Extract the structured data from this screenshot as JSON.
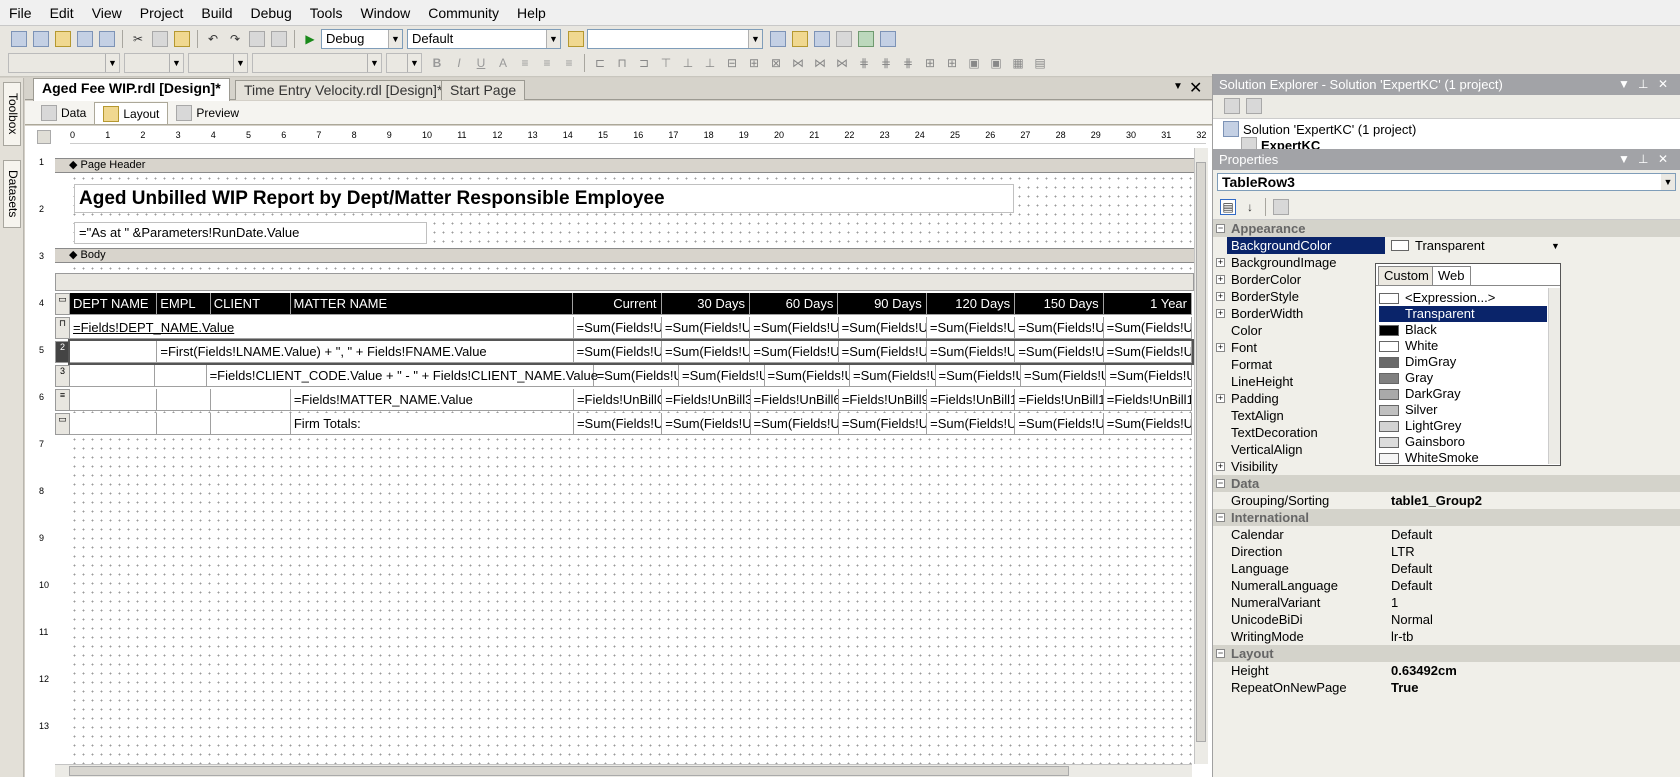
{
  "menu": [
    "File",
    "Edit",
    "View",
    "Project",
    "Build",
    "Debug",
    "Tools",
    "Window",
    "Community",
    "Help"
  ],
  "toolbar": {
    "config": "Debug",
    "platform": "Default"
  },
  "side_tabs": {
    "toolbox": "Toolbox",
    "datasets": "Datasets"
  },
  "doc_tabs": [
    {
      "label": "Aged Fee WIP.rdl [Design]*",
      "active": true
    },
    {
      "label": "Time Entry Velocity.rdl [Design]*",
      "active": false
    },
    {
      "label": "Start Page",
      "active": false
    }
  ],
  "view_tabs": [
    "Data",
    "Layout",
    "Preview"
  ],
  "ruler": {
    "h": [
      "0",
      "1",
      "2",
      "3",
      "4",
      "5",
      "6",
      "7",
      "8",
      "9",
      "10",
      "11",
      "12",
      "13",
      "14",
      "15",
      "16",
      "17",
      "18",
      "19",
      "20",
      "21",
      "22",
      "23",
      "24",
      "25",
      "26",
      "27",
      "28",
      "29",
      "30",
      "31",
      "32"
    ],
    "v": [
      "1",
      "2",
      "3",
      "4",
      "5",
      "6",
      "7",
      "8",
      "9",
      "10",
      "11",
      "12",
      "13"
    ]
  },
  "report": {
    "page_header_label": "Page Header",
    "title": "Aged Unbilled WIP Report by Dept/Matter Responsible Employee",
    "as_at": "=\"As at \" &Parameters!RunDate.Value",
    "body_label": "Body",
    "header_row": [
      "DEPT NAME",
      "EMPL",
      "CLIENT",
      "MATTER NAME",
      "Current",
      "30 Days",
      "60 Days",
      "90 Days",
      "120 Days",
      "150 Days",
      "1 Year"
    ],
    "group1": "=Fields!DEPT_NAME.Value",
    "group2": "=First(Fields!LNAME.Value) + \", \" + Fields!FNAME.Value",
    "group3": "=Fields!CLIENT_CODE.Value + \" - \" + Fields!CLIENT_NAME.Value",
    "detail": "=Fields!MATTER_NAME.Value",
    "footer": "Firm Totals:",
    "sum_cells": [
      "=Sum(Fields!Ur",
      "=Sum(Fields!Ur",
      "=Sum(Fields!Ur",
      "=Sum(Fields!Ur",
      "=Sum(Fields!Ur",
      "=Sum(Fields!Ur",
      "=Sum(Fields!Ur"
    ],
    "detail_cells": [
      "=Fields!UnBillC",
      "=Fields!UnBill3(",
      "=Fields!UnBill6",
      "=Fields!UnBill9(",
      "=Fields!UnBill1.",
      "=Fields!UnBill1:",
      "=Fields!UnBill1"
    ]
  },
  "solution_explorer": {
    "title": "Solution Explorer - Solution 'ExpertKC' (1 project)",
    "solution": "Solution 'ExpertKC' (1 project)",
    "project": "ExpertKC"
  },
  "properties": {
    "title": "Properties",
    "object": "TableRow3",
    "categories": {
      "appearance": "Appearance",
      "data": "Data",
      "international": "International",
      "layout": "Layout"
    },
    "appearance": [
      {
        "name": "BackgroundColor",
        "value": "Transparent"
      },
      {
        "name": "BackgroundImage",
        "value": ""
      },
      {
        "name": "BorderColor",
        "value": ""
      },
      {
        "name": "BorderStyle",
        "value": ""
      },
      {
        "name": "BorderWidth",
        "value": ""
      },
      {
        "name": "Color",
        "value": ""
      },
      {
        "name": "Font",
        "value": ""
      },
      {
        "name": "Format",
        "value": ""
      },
      {
        "name": "LineHeight",
        "value": ""
      },
      {
        "name": "Padding",
        "value": ""
      },
      {
        "name": "TextAlign",
        "value": ""
      },
      {
        "name": "TextDecoration",
        "value": ""
      },
      {
        "name": "VerticalAlign",
        "value": ""
      },
      {
        "name": "Visibility",
        "value": ""
      }
    ],
    "data": [
      {
        "name": "Grouping/Sorting",
        "value": "table1_Group2"
      }
    ],
    "international": [
      {
        "name": "Calendar",
        "value": "Default"
      },
      {
        "name": "Direction",
        "value": "LTR"
      },
      {
        "name": "Language",
        "value": "Default"
      },
      {
        "name": "NumeralLanguage",
        "value": "Default"
      },
      {
        "name": "NumeralVariant",
        "value": "1"
      },
      {
        "name": "UnicodeBiDi",
        "value": "Normal"
      },
      {
        "name": "WritingMode",
        "value": "lr-tb"
      }
    ],
    "layout": [
      {
        "name": "Height",
        "value": "0.63492cm"
      },
      {
        "name": "RepeatOnNewPage",
        "value": "True"
      }
    ]
  },
  "color_dropdown": {
    "tabs": [
      "Custom",
      "Web"
    ],
    "items": [
      {
        "label": "<Expression...>",
        "color": "#ffffff"
      },
      {
        "label": "Transparent",
        "color": "#0a246a"
      },
      {
        "label": "Black",
        "color": "#000000"
      },
      {
        "label": "White",
        "color": "#ffffff"
      },
      {
        "label": "DimGray",
        "color": "#696969"
      },
      {
        "label": "Gray",
        "color": "#808080"
      },
      {
        "label": "DarkGray",
        "color": "#a9a9a9"
      },
      {
        "label": "Silver",
        "color": "#c0c0c0"
      },
      {
        "label": "LightGrey",
        "color": "#d3d3d3"
      },
      {
        "label": "Gainsboro",
        "color": "#dcdcdc"
      },
      {
        "label": "WhiteSmoke",
        "color": "#f5f5f5"
      }
    ]
  }
}
